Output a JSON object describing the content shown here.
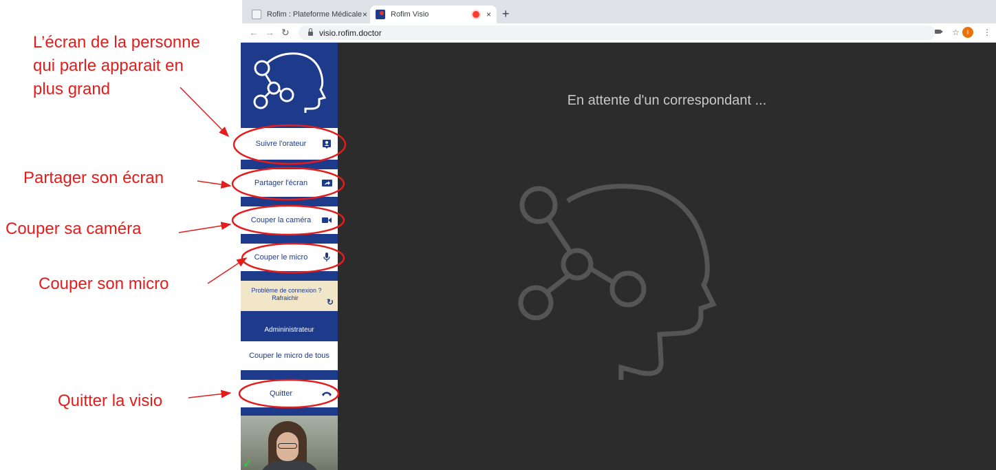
{
  "browser": {
    "tabs": [
      {
        "title": "Rofim : Plateforme Médicale, T",
        "active": false
      },
      {
        "title": "Rofim Visio",
        "active": true,
        "recording": true
      }
    ],
    "new_tab_symbol": "+",
    "close_symbol": "×",
    "url": "visio.rofim.doctor",
    "avatar_letter": "I",
    "icons": {
      "back": "back-arrow-icon",
      "forward": "forward-arrow-icon",
      "reload": "reload-icon",
      "lock": "lock-icon",
      "camera": "camera-icon",
      "star": "star-icon",
      "menu": "kebab-menu-icon"
    }
  },
  "sidebar": {
    "logo": "rofim-head-logo",
    "items": [
      {
        "label": "Suivre l'orateur",
        "icon": "speaker-badge-icon"
      },
      {
        "label": "Partager l'écran",
        "icon": "screen-share-icon"
      },
      {
        "label": "Couper la caméra",
        "icon": "videocam-icon"
      },
      {
        "label": "Couper le micro",
        "icon": "mic-icon"
      }
    ],
    "connection": {
      "line1": "Problème de connexion ?",
      "line2": "Rafraichir",
      "icon": "refresh-icon"
    },
    "admin_header": "Admininistrateur",
    "mute_all": "Couper le micro de tous",
    "quit": {
      "label": "Quitter",
      "icon": "hang-up-icon"
    }
  },
  "main": {
    "waiting_text": "En attente d'un correspondant ..."
  },
  "annotations": {
    "speaker": [
      "L’écran de la personne",
      "qui parle apparait en",
      "plus grand"
    ],
    "share": "Partager son écran",
    "camera": "Couper sa caméra",
    "micro": "Couper son micro",
    "quit": "Quitter la visio"
  },
  "colors": {
    "sidebar": "#1e3a8a",
    "main_bg": "#2c2c2c",
    "annotation": "#e31c1c",
    "connection_bg": "#f1e6c8"
  }
}
